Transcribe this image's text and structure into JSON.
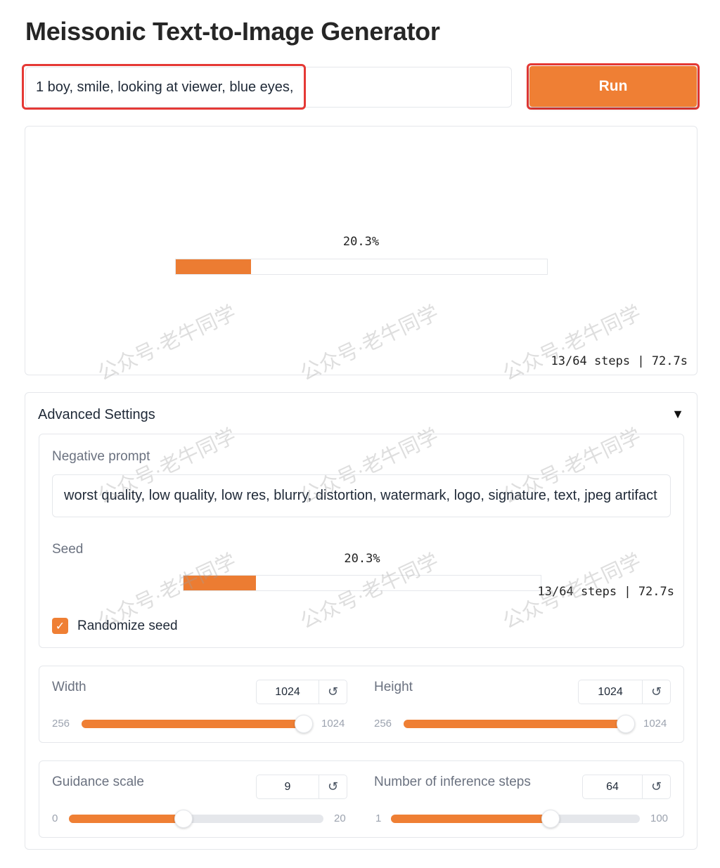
{
  "app": {
    "title": "Meissonic Text-to-Image Generator"
  },
  "prompt": {
    "value": "1 boy, smile, looking at viewer, blue eyes,"
  },
  "run_button": {
    "label": "Run",
    "color": "#ef7f34"
  },
  "output": {
    "progress_percent_label": "20.3%",
    "progress_fraction": 0.203,
    "eta": "13/64 steps | 72.7s"
  },
  "advanced": {
    "title": "Advanced Settings",
    "toggle_icon": "▼",
    "negative_prompt": {
      "label": "Negative prompt",
      "value": "worst quality, low quality, low res, blurry, distortion, watermark, logo, signature, text, jpeg artifact"
    },
    "seed": {
      "label": "Seed",
      "progress_percent_label": "20.3%",
      "progress_fraction": 0.203,
      "eta": "13/64 steps | 72.7s"
    },
    "randomize_seed": {
      "label": "Randomize seed",
      "checked": true
    },
    "width": {
      "label": "Width",
      "value": "1024",
      "min": "256",
      "max": "1024",
      "fraction": 1.0
    },
    "height": {
      "label": "Height",
      "value": "1024",
      "min": "256",
      "max": "1024",
      "fraction": 1.0
    },
    "guidance_scale": {
      "label": "Guidance scale",
      "value": "9",
      "min": "0",
      "max": "20",
      "fraction": 0.45
    },
    "inference_steps": {
      "label": "Number of inference steps",
      "value": "64",
      "min": "1",
      "max": "100",
      "fraction": 0.64
    }
  },
  "watermark": {
    "text": "公众号·老牛同学"
  },
  "colors": {
    "accent": "#ef7f34",
    "highlight": "#e53935"
  }
}
